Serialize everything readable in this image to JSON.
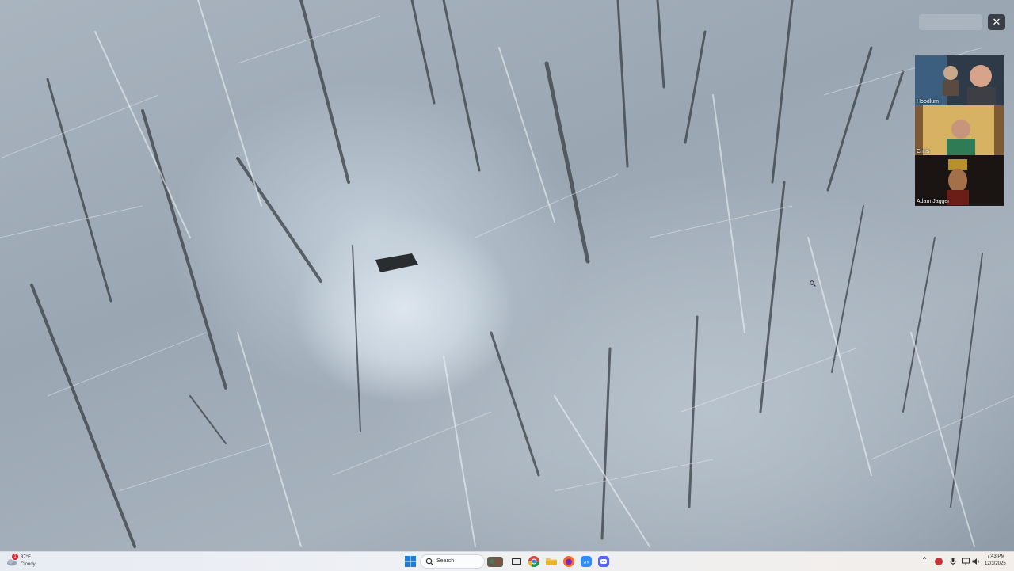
{
  "call": {
    "participants": [
      {
        "name": "Hoodlum"
      },
      {
        "name": "Chris"
      },
      {
        "name": "Adam Jagger"
      }
    ]
  },
  "taskbar": {
    "weather": {
      "temperature": "37°F",
      "condition": "Cloudy",
      "alert_count": "1"
    },
    "search_label": "Search",
    "pinned_apps": [
      "start-icon",
      "search-icon",
      "game-icon",
      "task-view-icon",
      "chrome-icon",
      "file-explorer-icon",
      "firefox-icon",
      "zoom-icon",
      "discord-icon"
    ],
    "tray": {
      "time": "7:43 PM",
      "date": "12/3/2025"
    }
  },
  "colors": {
    "taskbar_bg": "#eef0f4",
    "snow": "#dde6ee",
    "tree_trunk": "#2f3338"
  }
}
